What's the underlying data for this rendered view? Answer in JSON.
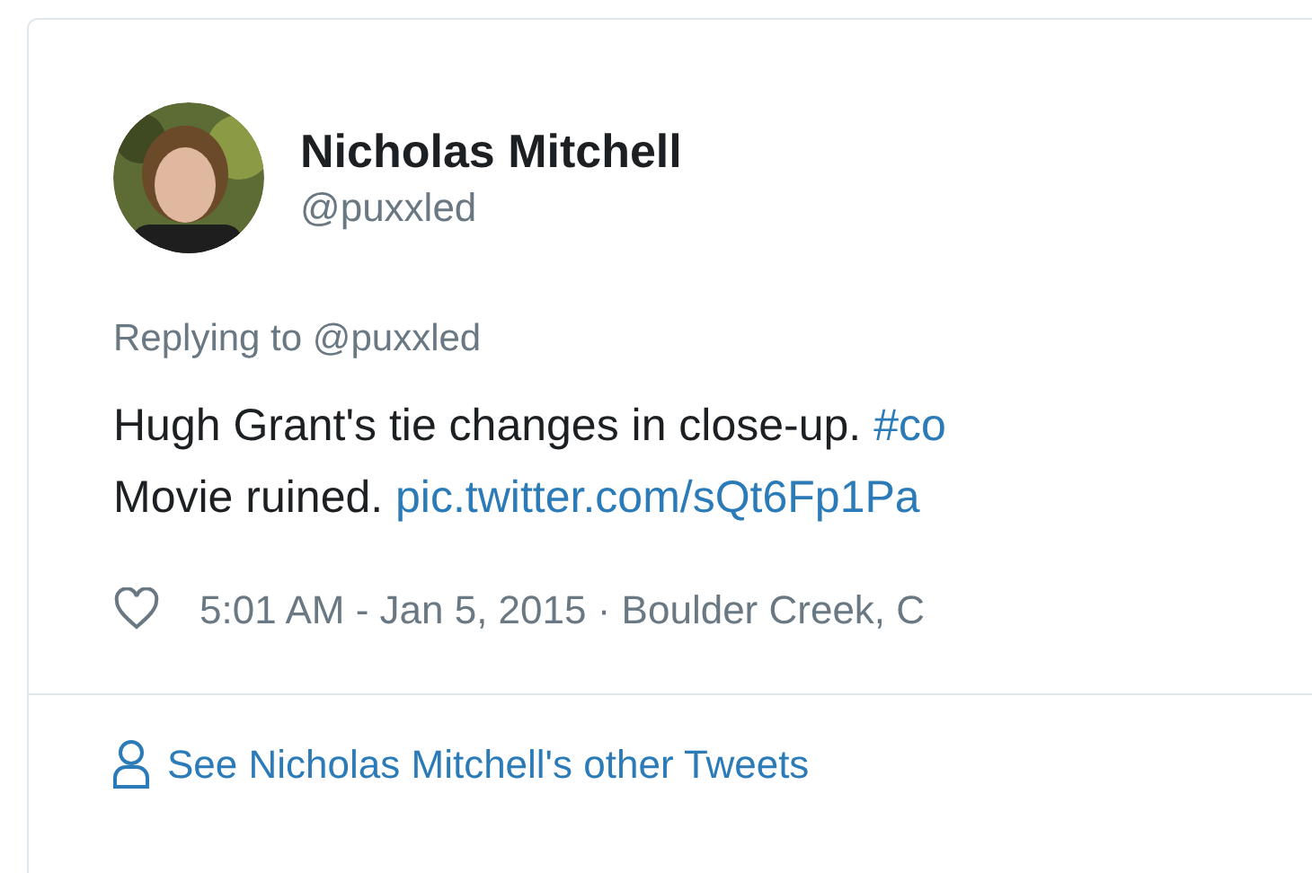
{
  "author": {
    "name": "Nicholas Mitchell",
    "handle": "@puxxled"
  },
  "replying_to": "Replying to @puxxled",
  "text_lines": [
    {
      "text": "Hugh Grant's tie changes in close-up. ",
      "link": "#co"
    },
    {
      "text": "Movie ruined. ",
      "link": "pic.twitter.com/sQt6Fp1Pa"
    }
  ],
  "meta": {
    "timestamp": "5:01 AM - Jan 5, 2015 · Boulder Creek, C"
  },
  "footer": {
    "link": "See Nicholas Mitchell's other Tweets"
  }
}
